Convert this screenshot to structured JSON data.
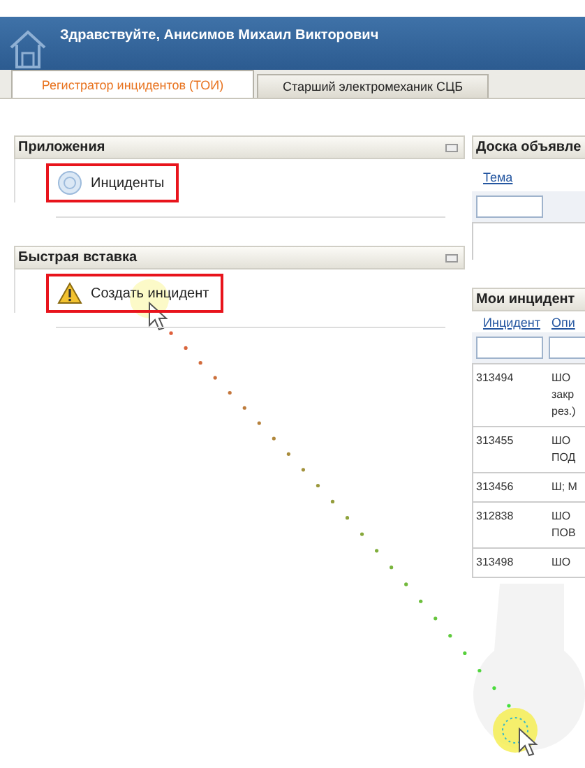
{
  "header": {
    "greeting": "Здравствуйте, Анисимов Михаил Викторович"
  },
  "tabs": [
    {
      "label": "Регистратор инцидентов (ТОИ)",
      "selected": true
    },
    {
      "label": "Старший электромеханик СЦБ",
      "selected": false
    }
  ],
  "left_panels": [
    {
      "title": "Приложения",
      "items": [
        {
          "kind": "app",
          "label": "Инциденты",
          "highlighted": true
        }
      ]
    },
    {
      "title": "Быстрая вставка",
      "items": [
        {
          "kind": "warning",
          "label": "Создать инцидент",
          "highlighted": true
        }
      ]
    }
  ],
  "board": {
    "title": "Доска объявле",
    "columns": [
      "Тема"
    ]
  },
  "incidents": {
    "title": "Мои инцидент",
    "columns": [
      "Инцидент",
      "Опи"
    ],
    "rows": [
      {
        "id": "313494",
        "description": [
          "ШО",
          "закр",
          "рез.)"
        ]
      },
      {
        "id": "313455",
        "description": [
          "ШО",
          "ПОД"
        ]
      },
      {
        "id": "313456",
        "description": [
          "Ш; М"
        ]
      },
      {
        "id": "312838",
        "description": [
          "ШО",
          "ПОВ"
        ]
      },
      {
        "id": "313498",
        "description": [
          "ШО"
        ]
      }
    ]
  }
}
